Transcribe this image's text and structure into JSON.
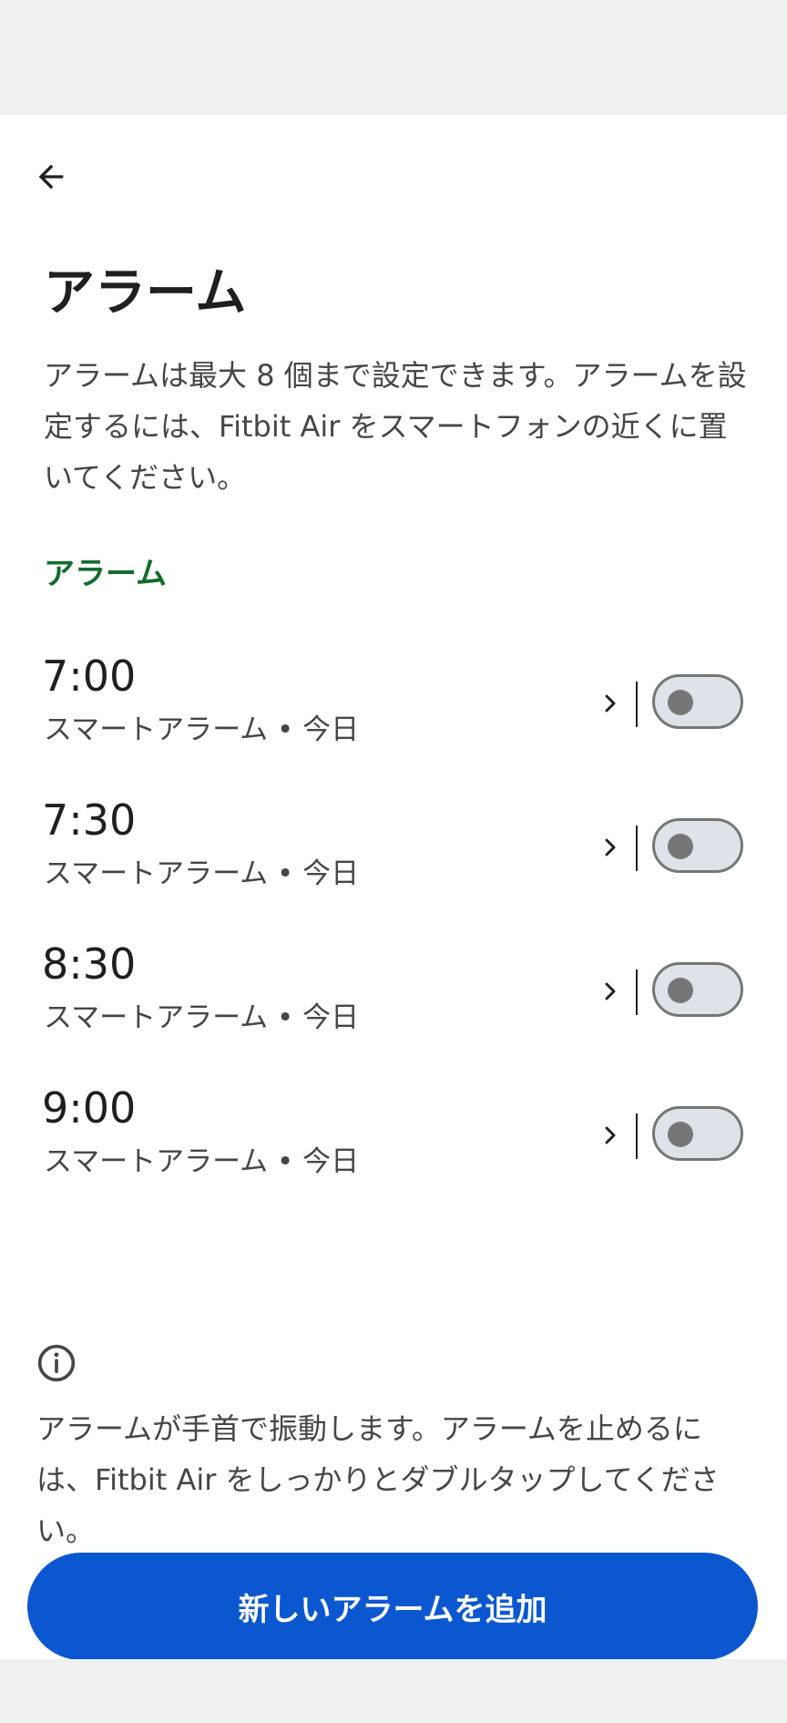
{
  "header": {
    "back_icon": "arrow-left-icon",
    "title": "アラーム",
    "description": "アラームは最大 8 個まで設定できます。アラームを設定するには、Fitbit Air をスマートフォンの近くに置いてください。"
  },
  "alarms_section": {
    "title": "アラーム",
    "items": [
      {
        "time": "7:00",
        "subtitle": "スマートアラーム • 今日",
        "enabled": false
      },
      {
        "time": "7:30",
        "subtitle": "スマートアラーム • 今日",
        "enabled": false
      },
      {
        "time": "8:30",
        "subtitle": "スマートアラーム • 今日",
        "enabled": false
      },
      {
        "time": "9:00",
        "subtitle": "スマートアラーム • 今日",
        "enabled": false
      }
    ]
  },
  "info": {
    "icon": "info-icon",
    "text": "アラームが手首で振動します。アラームを止めるには、Fitbit Air をしっかりとダブルタップしてください。"
  },
  "add_button": {
    "label": "新しいアラームを追加"
  },
  "colors": {
    "accent_green": "#146c2e",
    "primary_blue": "#0b57d0",
    "toggle_off_track": "#dee3ea",
    "toggle_off_outline": "#747775"
  }
}
